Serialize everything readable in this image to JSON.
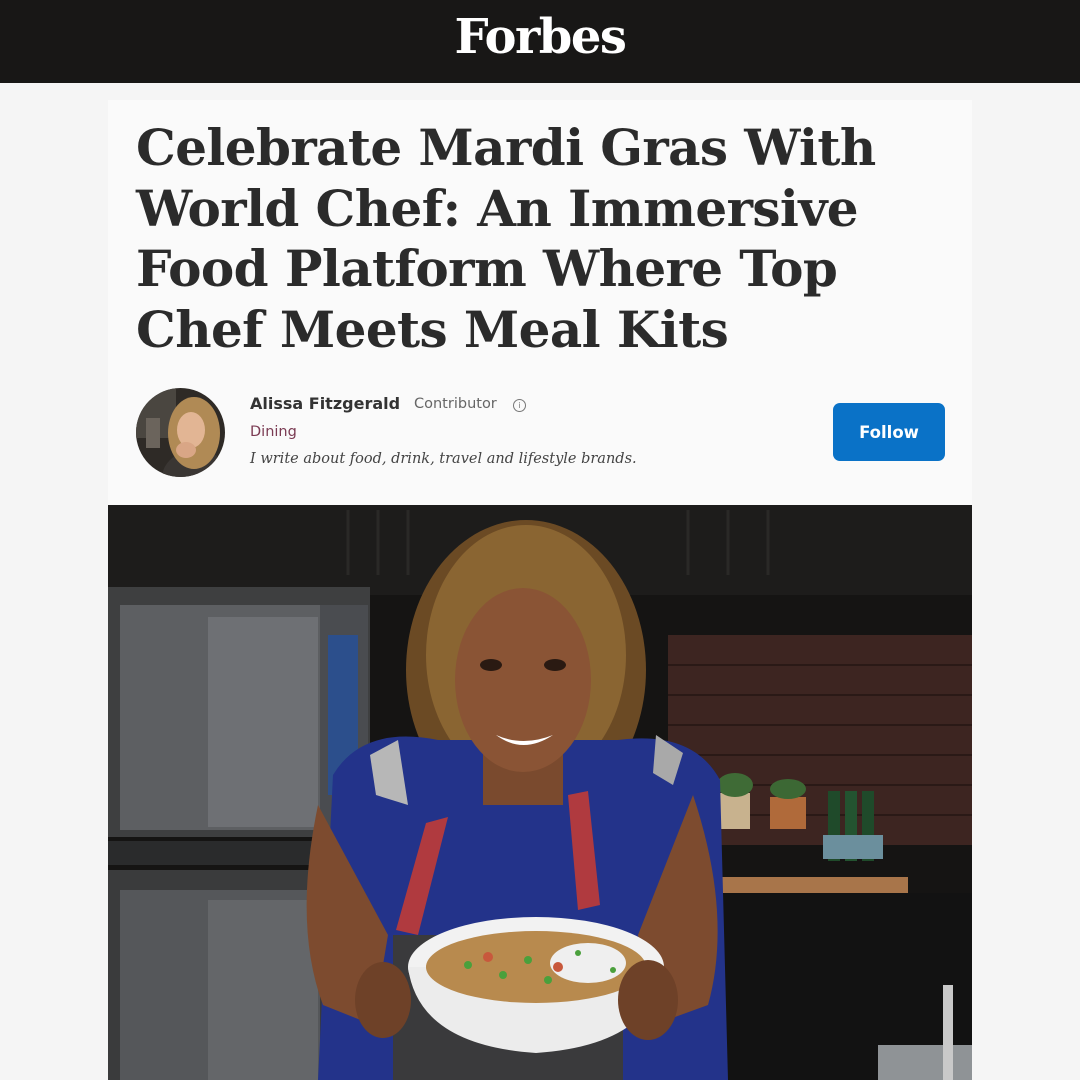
{
  "header": {
    "logo": "Forbes"
  },
  "article": {
    "headline": "Celebrate Mardi Gras With World Chef: An Immersive Food Platform Where Top Chef Meets Meal Kits"
  },
  "author": {
    "name": "Alissa Fitzgerald",
    "role": "Contributor",
    "info_icon": "ⓘ",
    "category": "Dining",
    "bio": "I write about food, drink, travel and lifestyle brands.",
    "follow_label": "Follow"
  },
  "colors": {
    "header_bg": "#181716",
    "follow_button": "#0a72c7",
    "category_text": "#7a3a52"
  }
}
